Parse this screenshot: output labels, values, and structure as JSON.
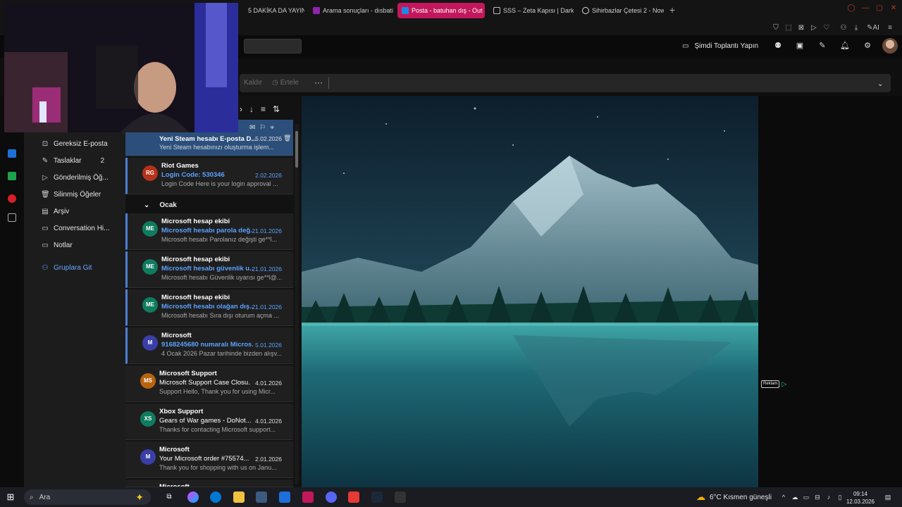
{
  "browser": {
    "tabs": [
      {
        "label": "5 DAKİKA DA YAYIN",
        "icon": "stream-icon"
      },
      {
        "label": "Arama sonuçları - dısbati",
        "icon": "search-result-icon"
      },
      {
        "label": "Posta - batuhan dış - Out",
        "icon": "outlook-icon",
        "active": true
      },
      {
        "label": "SSS – Zeta Kapısı | DarkO",
        "icon": "page-icon"
      },
      {
        "label": "Sihirbazlar Çetesi 2 - Now",
        "icon": "movie-icon"
      }
    ],
    "new_tab": "+"
  },
  "header": {
    "meet_now_label": "Şimdi Toplantı Yapın"
  },
  "ribbon": {
    "delete_label": "Kaldır",
    "snooze_label": "Ertele",
    "more_label": "···"
  },
  "folders": [
    {
      "label": "Gereksiz E-posta",
      "icon": "junk-icon",
      "count": ""
    },
    {
      "label": "Taslaklar",
      "icon": "drafts-icon",
      "count": "2"
    },
    {
      "label": "Gönderilmiş Öğ...",
      "icon": "sent-icon",
      "count": ""
    },
    {
      "label": "Silinmiş Öğeler",
      "icon": "trash-icon",
      "count": ""
    },
    {
      "label": "Arşiv",
      "icon": "archive-icon",
      "count": ""
    },
    {
      "label": "Conversation Hi...",
      "icon": "folder-icon",
      "count": ""
    },
    {
      "label": "Notlar",
      "icon": "folder-icon",
      "count": ""
    }
  ],
  "groups_link": "Gruplara Git",
  "message_list": {
    "group_label": "Ocak",
    "messages_top": [
      {
        "sender": "Yeni Steam hesabı E-posta D...",
        "subject": "",
        "date": "5.02.2026",
        "preview": "Yeni Steam hesabınızı oluşturma işlem...",
        "avatar": "",
        "unread": false,
        "selected": true
      },
      {
        "sender": "Riot Games",
        "subject": "Login Code: 530346",
        "date": "2.02.2026",
        "preview": "Login Code Here is your login approval ...",
        "avatar": "RG",
        "avatar_color": "#b5331b",
        "unread": true
      }
    ],
    "messages": [
      {
        "sender": "Microsoft hesap ekibi",
        "subject": "Microsoft hesabı parola değ...",
        "date": "21.01.2026",
        "preview": "Microsoft hesabı Parolanız değişti ge**l...",
        "avatar": "ME",
        "avatar_color": "#0f7b5f",
        "unread": true
      },
      {
        "sender": "Microsoft hesap ekibi",
        "subject": "Microsoft hesabı güvenlik u...",
        "date": "21.01.2026",
        "preview": "Microsoft hesabı Güvenlik uyarısı ge**l@...",
        "avatar": "ME",
        "avatar_color": "#0f7b5f",
        "unread": true
      },
      {
        "sender": "Microsoft hesap ekibi",
        "subject": "Microsoft hesabı olağan dış...",
        "date": "21.01.2026",
        "preview": "Microsoft hesabı Sıra dışı oturum açma ...",
        "avatar": "ME",
        "avatar_color": "#0f7b5f",
        "unread": true
      },
      {
        "sender": "Microsoft",
        "subject": "9168245680 numaralı Micros...",
        "date": "5.01.2026",
        "preview": "4 Ocak 2026 Pazar tarihinde bizden alışv...",
        "avatar": "M",
        "avatar_color": "#3a3fa8",
        "unread": true
      },
      {
        "sender": "Microsoft Support",
        "subject": "Microsoft Support Case Closu...",
        "date": "4.01.2026",
        "preview": "Support Hello, Thank you for using Micr...",
        "avatar": "MS",
        "avatar_color": "#b8640e",
        "unread": false
      },
      {
        "sender": "Xbox Support",
        "subject": "Gears of War games - DoNot...",
        "date": "4.01.2026",
        "preview": "Thanks for contacting Microsoft support...",
        "avatar": "XS",
        "avatar_color": "#0f7b5f",
        "unread": false
      },
      {
        "sender": "Microsoft",
        "subject": "Your Microsoft order #75574...",
        "date": "2.01.2026",
        "preview": "Thank you for shopping with us on Janu...",
        "avatar": "M",
        "avatar_color": "#3a3fa8",
        "unread": false
      },
      {
        "sender": "Microsoft",
        "subject": "",
        "date": "",
        "preview": "",
        "avatar": "M",
        "avatar_color": "#3a3fa8",
        "unread": false
      }
    ]
  },
  "reading_pane": {
    "ad_label": "Reklam"
  },
  "taskbar": {
    "search_placeholder": "Ara",
    "weather": "6°C  Kısmen güneşli",
    "time": "09:14",
    "date": "12.03.2026"
  },
  "colors": {
    "accent": "#4c7fd3",
    "unread_blue": "#5aa2ff",
    "selected": "#2b4f7a",
    "active_tab": "#c2185b"
  }
}
